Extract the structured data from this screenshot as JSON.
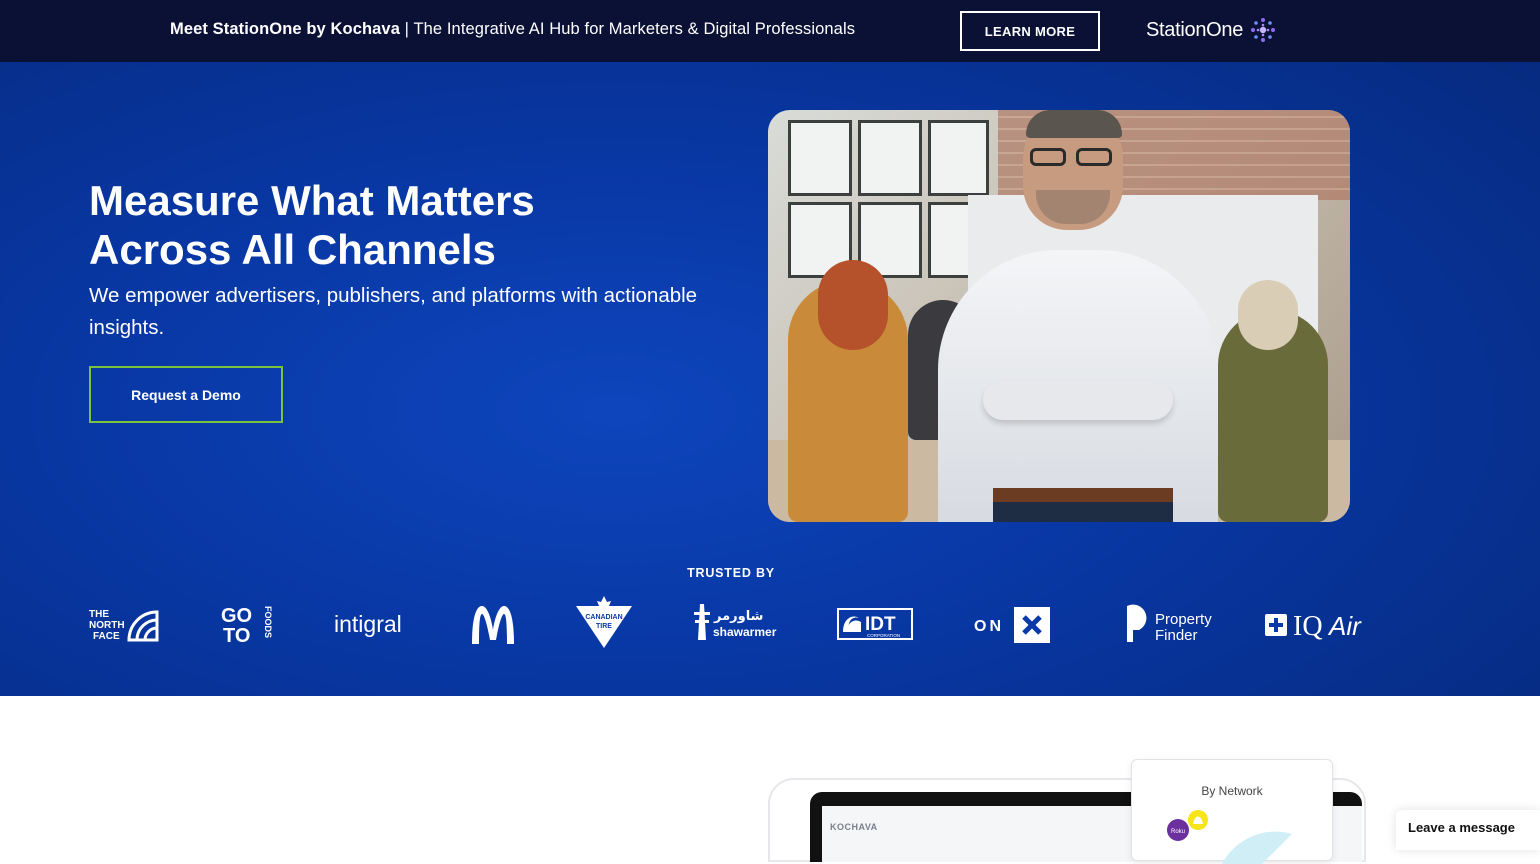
{
  "banner": {
    "brand_intro": "Meet StationOne by Kochava",
    "separator": " | ",
    "tagline": "The Integrative AI Hub for Marketers & Digital Professionals",
    "cta": "LEARN MORE",
    "logo_text": "StationOne"
  },
  "hero": {
    "title_line1": "Measure What Matters",
    "title_line2": "Across All Channels",
    "subtitle": "We empower advertisers, publishers, and platforms with actionable insights.",
    "cta": "Request a Demo",
    "trusted_label": "TRUSTED BY",
    "logos": [
      {
        "name": "THE NORTH FACE"
      },
      {
        "name": "GO TO FOODS"
      },
      {
        "name": "intigral"
      },
      {
        "name": "McDonald's"
      },
      {
        "name": "CANADIAN TIRE"
      },
      {
        "name": "shawarmer"
      },
      {
        "name": "IDT CORPORATION"
      },
      {
        "name": "ON X"
      },
      {
        "name": "Property Finder"
      },
      {
        "name": "IQAir"
      }
    ]
  },
  "lower": {
    "dashboard_brand": "KOCHAVA",
    "card_title": "By Network",
    "chat_label": "Leave a message"
  },
  "colors": {
    "banner_bg": "#0b1135",
    "hero_bg": "#0837a3",
    "demo_border": "#7cc33d"
  }
}
